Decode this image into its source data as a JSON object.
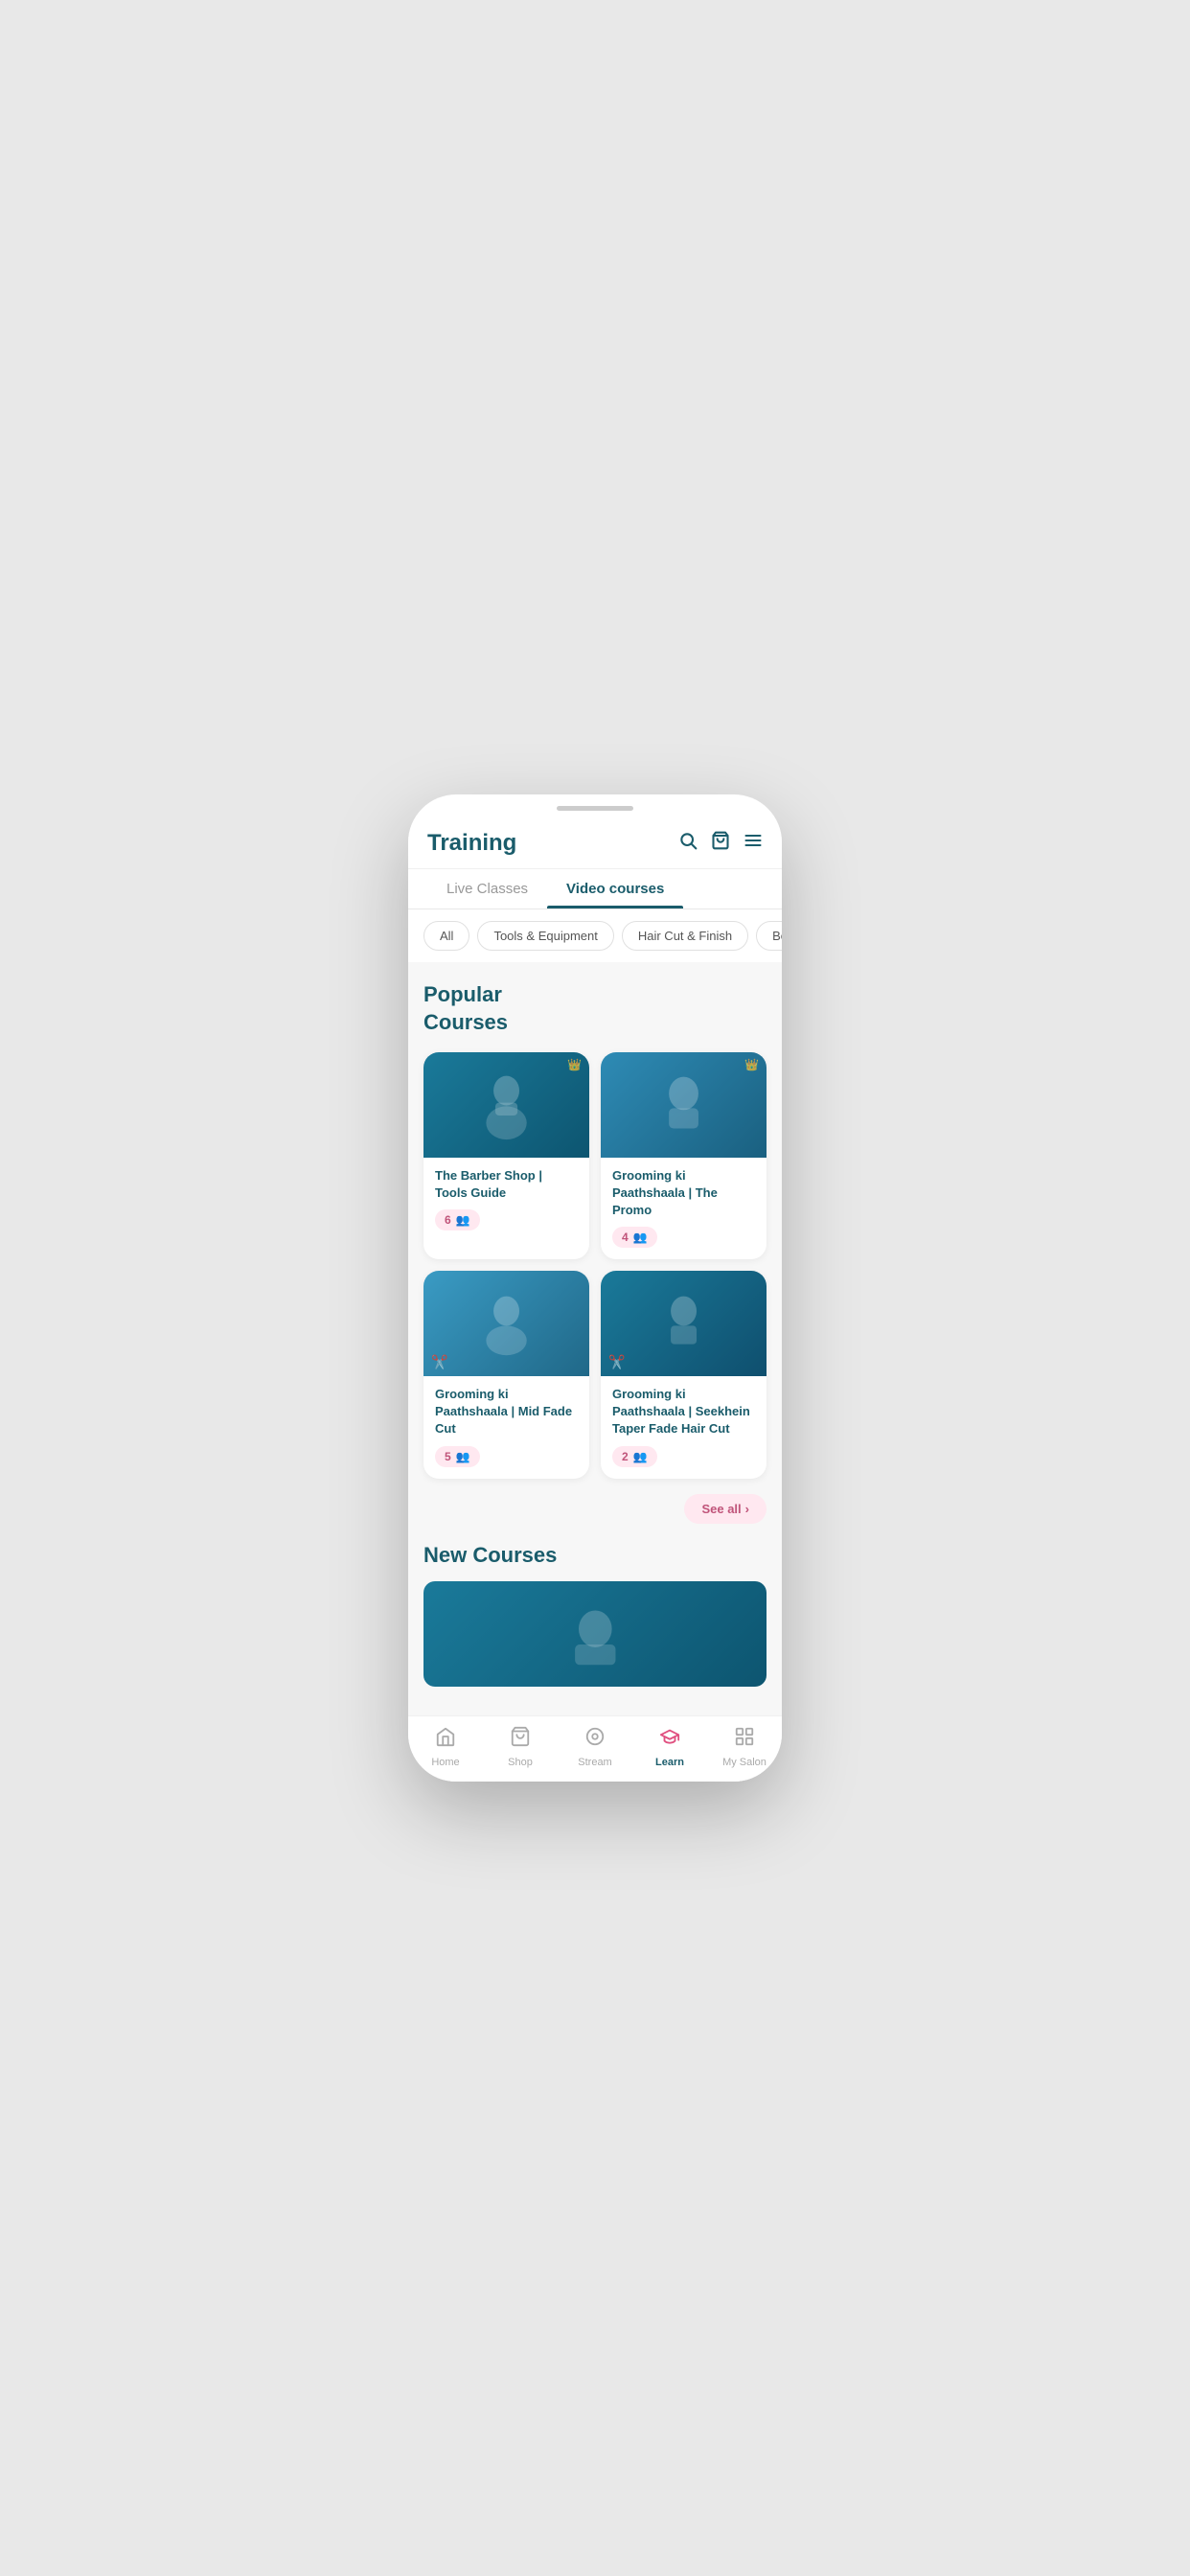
{
  "header": {
    "title": "Training",
    "search_icon": "🔍",
    "cart_icon": "🛒",
    "menu_icon": "☰"
  },
  "tabs": [
    {
      "id": "live",
      "label": "Live Classes",
      "active": false
    },
    {
      "id": "video",
      "label": "Video courses",
      "active": true
    }
  ],
  "filters": [
    {
      "id": "all",
      "label": "All",
      "active": false
    },
    {
      "id": "tools",
      "label": "Tools & Equipment",
      "active": false
    },
    {
      "id": "haircut",
      "label": "Hair Cut & Finish",
      "active": false
    },
    {
      "id": "beard",
      "label": "Beard",
      "active": false
    }
  ],
  "popular_section": {
    "title": "Popular\nCourses"
  },
  "courses": [
    {
      "id": 1,
      "title": "The Barber Shop | Tools Guide",
      "students": 6,
      "thumb_class": "thumb-1",
      "has_crown": true,
      "has_scissors": false
    },
    {
      "id": 2,
      "title": "Grooming ki Paathshaala | The Promo",
      "students": 4,
      "thumb_class": "thumb-2",
      "has_crown": true,
      "has_scissors": false
    },
    {
      "id": 3,
      "title": "Grooming ki Paathshaala | Mid Fade Cut",
      "students": 5,
      "thumb_class": "thumb-3",
      "has_crown": false,
      "has_scissors": true
    },
    {
      "id": 4,
      "title": "Grooming ki Paathshaala | Seekhein Taper Fade Hair Cut",
      "students": 2,
      "thumb_class": "thumb-4",
      "has_crown": false,
      "has_scissors": true
    }
  ],
  "see_all_label": "See all",
  "new_courses_title": "New Courses",
  "bottom_nav": [
    {
      "id": "home",
      "label": "Home",
      "icon": "🏠",
      "active": false
    },
    {
      "id": "shop",
      "label": "Shop",
      "icon": "🛍",
      "active": false
    },
    {
      "id": "stream",
      "label": "Stream",
      "icon": "⊙",
      "active": false
    },
    {
      "id": "learn",
      "label": "Learn",
      "icon": "🎓",
      "active": true
    },
    {
      "id": "mysalon",
      "label": "My Salon",
      "icon": "🪪",
      "active": false
    }
  ]
}
